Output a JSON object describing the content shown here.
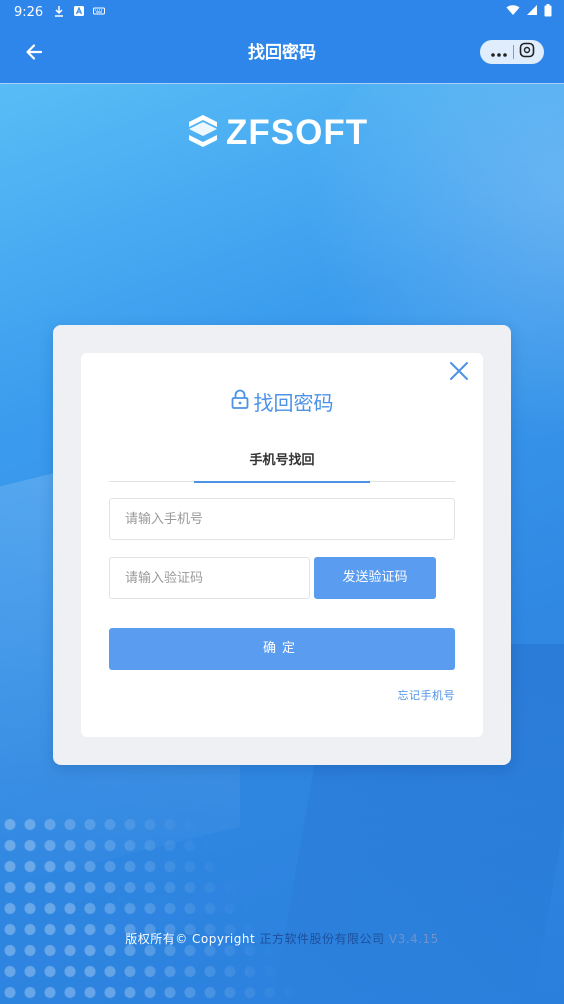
{
  "status_bar": {
    "time": "9:26",
    "icons": [
      "download-icon",
      "a-icon",
      "keyboard-icon",
      "wifi-icon",
      "signal-icon",
      "battery-icon"
    ]
  },
  "nav": {
    "title": "找回密码",
    "back_icon": "arrow-left-icon",
    "more_icon": "more-dots-icon",
    "close_icon": "exit-icon"
  },
  "logo": {
    "text": "ZFSOFT",
    "icon": "zfsoft-logo-icon"
  },
  "dialog": {
    "title": "找回密码",
    "title_icon": "lock-icon",
    "close_icon": "close-icon",
    "tab_label": "手机号找回",
    "phone_placeholder": "请输入手机号",
    "code_placeholder": "请输入验证码",
    "send_code_label": "发送验证码",
    "confirm_label": "确定",
    "forgot_phone_label": "忘记手机号"
  },
  "footer": {
    "copyright": "版权所有© Copyright",
    "company": "正方软件股份有限公司",
    "version": "V3.4.15"
  },
  "colors": {
    "nav_bg": "#2f86ea",
    "accent": "#4c92e6",
    "button_bg": "#5a9cf0"
  }
}
